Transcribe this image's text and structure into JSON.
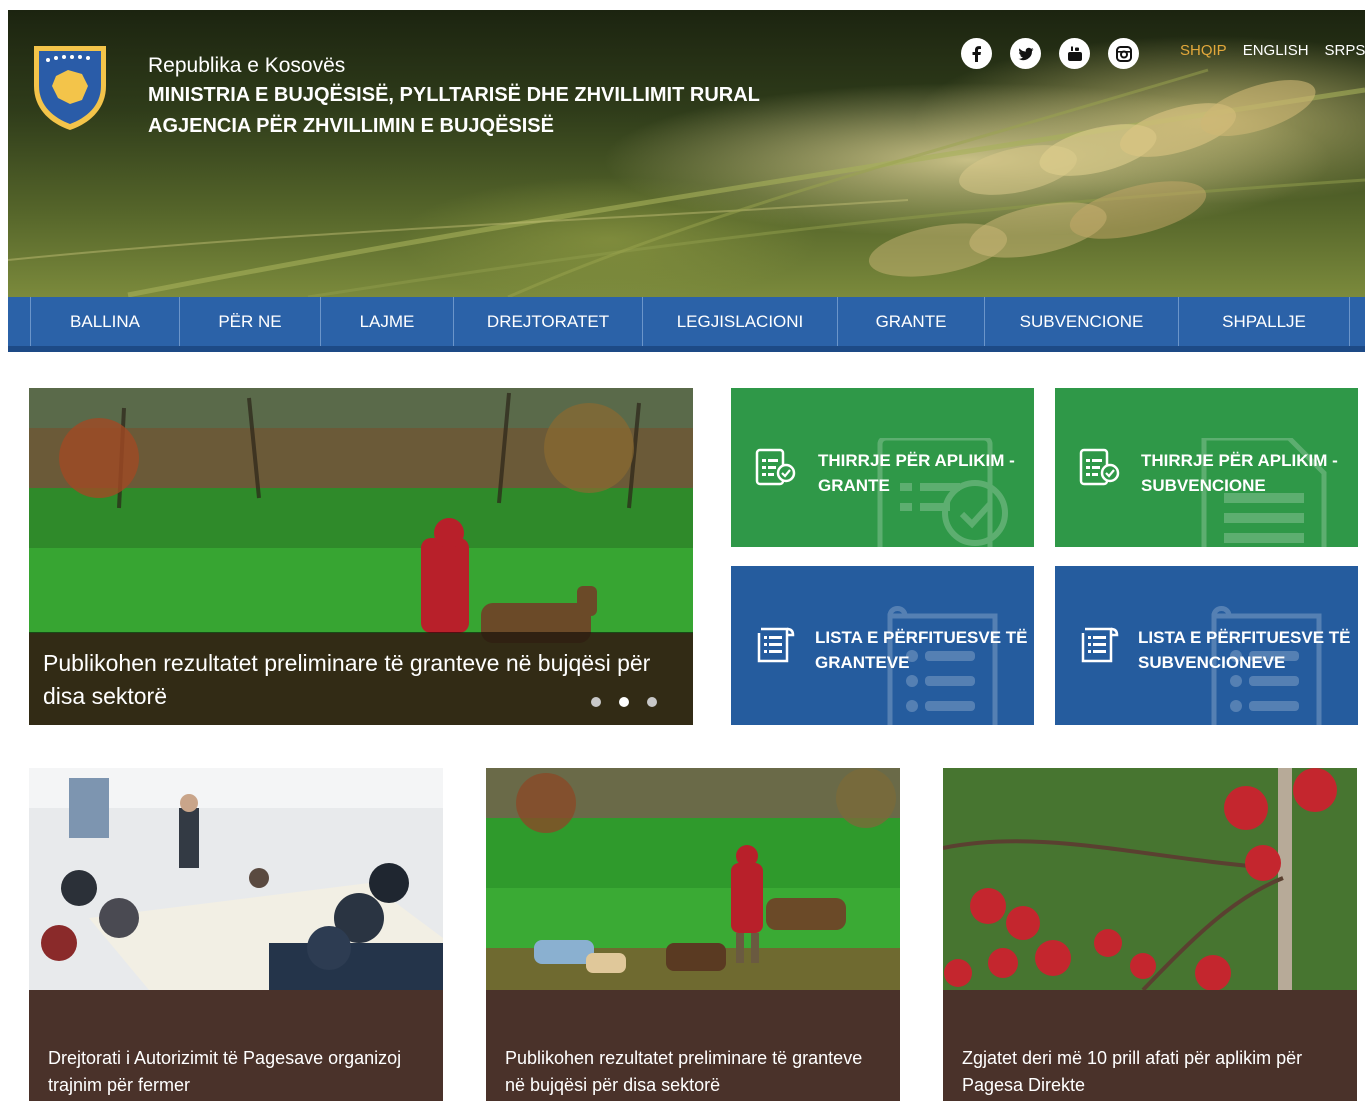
{
  "header": {
    "line1": "Republika e Kosovës",
    "line2": "MINISTRIA E BUJQËSISË, PYLLTARISË DHE ZHVILLIMIT RURAL",
    "line3": "AGJENCIA PËR ZHVILLIMIN E BUJQËSISË",
    "social": [
      "facebook-icon",
      "twitter-icon",
      "youtube-icon",
      "instagram-icon"
    ],
    "languages": [
      {
        "label": "SHQIP",
        "active": true
      },
      {
        "label": "ENGLISH",
        "active": false
      },
      {
        "label": "SRPSKI",
        "active": false
      }
    ]
  },
  "nav": {
    "items": [
      "BALLINA",
      "PËR NE",
      "LAJME",
      "DREJTORATET",
      "LEGJISLACIONI",
      "GRANTE",
      "SUBVENCIONE",
      "SHPALLJE"
    ]
  },
  "slider": {
    "caption": "Publikohen rezultatet preliminare të granteve në bujqësi për disa sektorë",
    "dots": 3,
    "active_dot": 2
  },
  "tiles": [
    {
      "label_line1": "THIRRJE PËR APLIKIM -",
      "label_line2": "GRANTE",
      "color": "#2f9848"
    },
    {
      "label_line1": "THIRRJE PËR APLIKIM -",
      "label_line2": "SUBVENCIONE",
      "color": "#2f9848"
    },
    {
      "label_line1": "LISTA E PËRFITUESVE TË",
      "label_line2": "GRANTEVE",
      "color": "#255c9e"
    },
    {
      "label_line1": "LISTA E PËRFITUESVE TË",
      "label_line2": "SUBVENCIONEVE",
      "color": "#255c9e"
    }
  ],
  "news": [
    {
      "title": "Drejtorati i Autorizimit të Pagesave organizoj trajnim për fermer"
    },
    {
      "title": "Publikohen rezultatet preliminare të granteve në bujqësi për disa sektorë"
    },
    {
      "title": "Zgjatet deri më 10 prill afati për aplikim për Pagesa Direkte"
    }
  ],
  "colors": {
    "nav": "#2b62a8",
    "green_tile": "#2f9848",
    "blue_tile": "#255c9e",
    "card_caption": "#4a322a",
    "active_language": "#e3a83b"
  }
}
